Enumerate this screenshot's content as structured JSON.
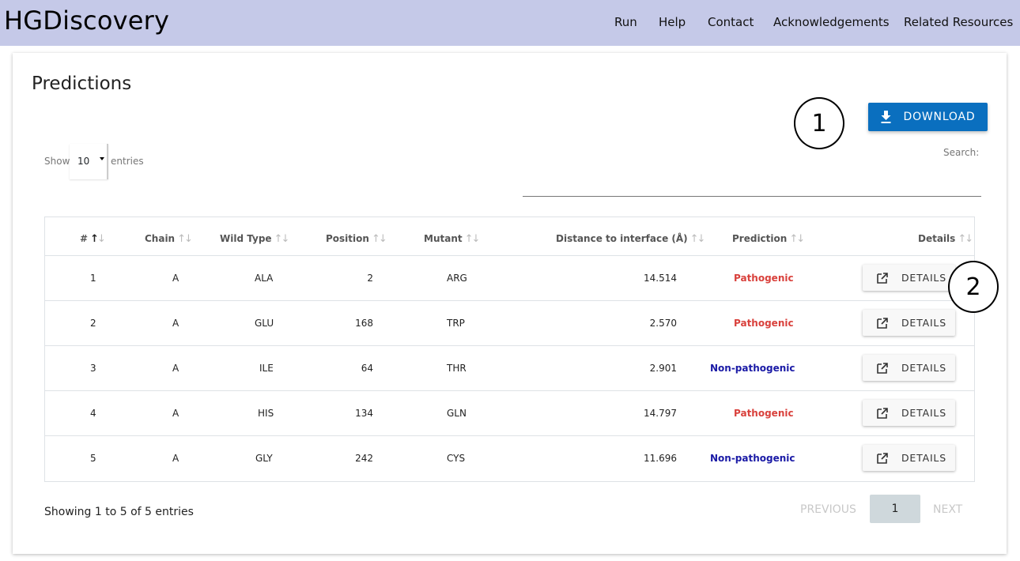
{
  "navbar": {
    "brand": "HGDiscovery",
    "links": [
      "Run",
      "Help",
      "Contact",
      "Acknowledgements",
      "Related Resources"
    ]
  },
  "page": {
    "title": "Predictions",
    "download_label": "DOWNLOAD",
    "callouts": [
      "1",
      "2"
    ]
  },
  "controls": {
    "show_label": "Show",
    "page_length": "10",
    "entries_label": "entries",
    "search_label": "Search:",
    "search_value": ""
  },
  "table": {
    "columns": [
      "#",
      "Chain",
      "Wild Type",
      "Position",
      "Mutant",
      "Distance to interface (Å)",
      "Prediction",
      "Details"
    ],
    "rows": [
      {
        "num": "1",
        "chain": "A",
        "wild_type": "ALA",
        "position": "2",
        "mutant": "ARG",
        "distance": "14.514",
        "prediction": "Pathogenic",
        "details": "DETAILS"
      },
      {
        "num": "2",
        "chain": "A",
        "wild_type": "GLU",
        "position": "168",
        "mutant": "TRP",
        "distance": "2.570",
        "prediction": "Pathogenic",
        "details": "DETAILS"
      },
      {
        "num": "3",
        "chain": "A",
        "wild_type": "ILE",
        "position": "64",
        "mutant": "THR",
        "distance": "2.901",
        "prediction": "Non-pathogenic",
        "details": "DETAILS"
      },
      {
        "num": "4",
        "chain": "A",
        "wild_type": "HIS",
        "position": "134",
        "mutant": "GLN",
        "distance": "14.797",
        "prediction": "Pathogenic",
        "details": "DETAILS"
      },
      {
        "num": "5",
        "chain": "A",
        "wild_type": "GLY",
        "position": "242",
        "mutant": "CYS",
        "distance": "11.696",
        "prediction": "Non-pathogenic",
        "details": "DETAILS"
      }
    ]
  },
  "footer": {
    "info": "Showing 1 to 5 of 5 entries",
    "previous": "PREVIOUS",
    "current_page": "1",
    "next": "NEXT"
  },
  "colors": {
    "navbar_bg": "#c5c9e8",
    "download_bg": "#0a6fbf",
    "pathogenic": "#d9413c",
    "non_pathogenic": "#1a1aa6",
    "active_page_bg": "#cfd8dc"
  },
  "icons": {
    "download": "download-icon",
    "details": "open-in-new-icon",
    "sort": "sort-arrows-icon"
  }
}
